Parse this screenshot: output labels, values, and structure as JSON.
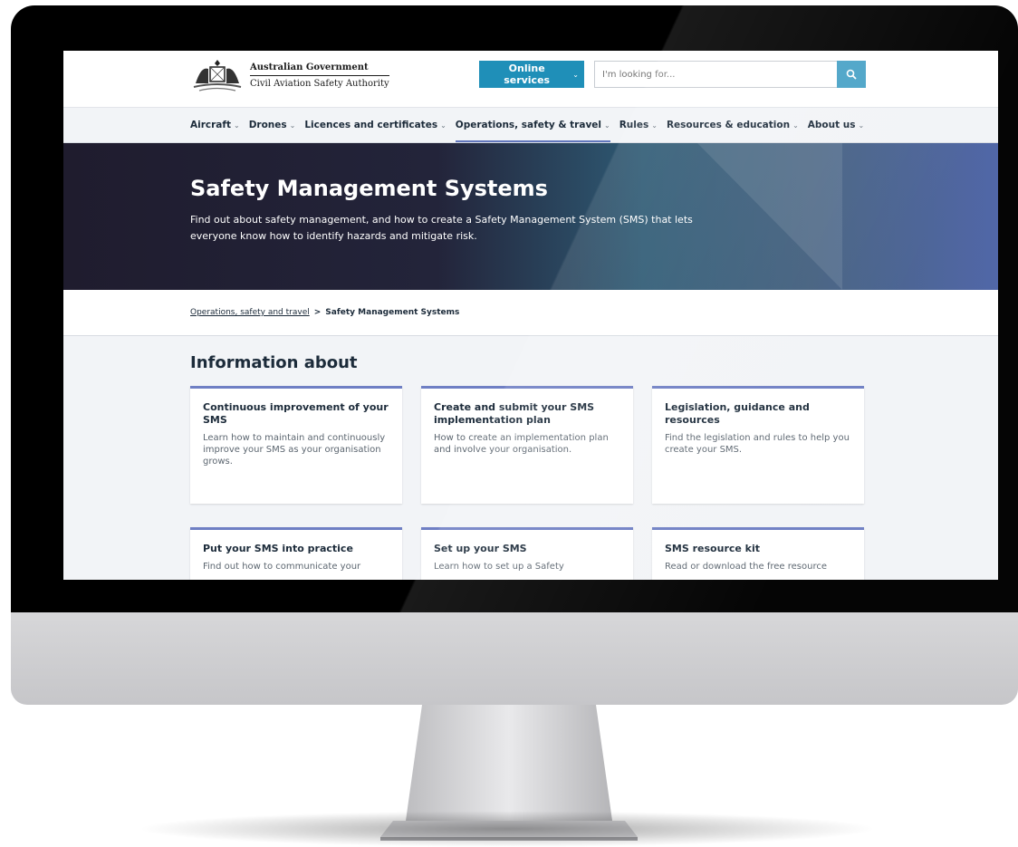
{
  "header": {
    "gov_line1": "Australian Government",
    "gov_line2": "Civil Aviation Safety Authority",
    "online_services_label": "Online services",
    "search_placeholder": "I'm looking for..."
  },
  "nav": {
    "items": [
      {
        "label": "Aircraft"
      },
      {
        "label": "Drones"
      },
      {
        "label": "Licences and certificates"
      },
      {
        "label": "Operations, safety & travel"
      },
      {
        "label": "Rules"
      },
      {
        "label": "Resources & education"
      },
      {
        "label": "About us"
      }
    ],
    "active_index": 3
  },
  "hero": {
    "title": "Safety Management Systems",
    "description": "Find out about safety management, and how to create a Safety Management System (SMS) that lets everyone know how to identify hazards and mitigate risk."
  },
  "breadcrumb": {
    "parent": "Operations, safety and travel",
    "separator": ">",
    "current": "Safety Management Systems"
  },
  "info": {
    "title": "Information about",
    "cards": [
      {
        "title": "Continuous improvement of your SMS",
        "text": "Learn how to maintain and continuously improve your SMS as your organisation grows."
      },
      {
        "title": "Create and submit your SMS implementation plan",
        "text": "How to create an implementation plan and involve your organisation."
      },
      {
        "title": "Legislation, guidance and resources",
        "text": "Find the legislation and rules to help you create your SMS."
      },
      {
        "title": "Put your SMS into practice",
        "text": "Find out how to communicate your"
      },
      {
        "title": "Set up your SMS",
        "text": "Learn how to set up a Safety"
      },
      {
        "title": "SMS resource kit",
        "text": "Read or download the free resource"
      }
    ]
  },
  "colors": {
    "accent": "#1f8fb8",
    "card_border": "#6f7fc4",
    "nav_active": "#6277bd"
  }
}
